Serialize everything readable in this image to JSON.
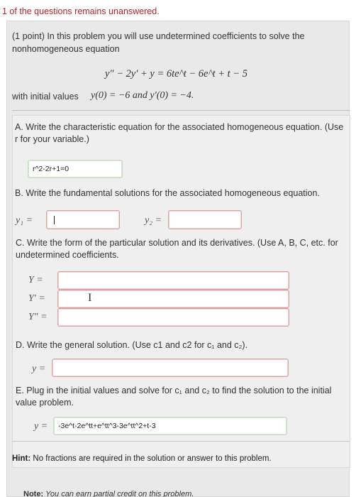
{
  "status": {
    "warning": "1 of the questions remains unanswered."
  },
  "problem": {
    "intro": "(1 point) In this problem you will use undetermined coefficients to solve the nonhomogeneous equation",
    "equation": "y″ − 2y′ + y = 6te^t − 6e^t + t − 5",
    "initial_label": "with initial values",
    "initial_values": "y(0) = −6 and y′(0) = −4."
  },
  "partA": {
    "prompt": "A. Write the characteristic equation for the associated homogeneous equation. (Use r for your variable.)",
    "answer": "r^2-2r+1=0"
  },
  "partB": {
    "prompt": "B. Write the fundamental solutions for the associated homogeneous equation.",
    "y1_label": "y₁ =",
    "y2_label": "y₂ =",
    "y1_value": "",
    "y2_value": ""
  },
  "partC": {
    "prompt": "C. Write the form of the particular solution and its derivatives. (Use A, B, C, etc. for undetermined coefficients.",
    "Y_label": "Y =",
    "Yp_label": "Y′ =",
    "Ypp_label": "Y″ =",
    "Y_value": "",
    "Yp_value": "",
    "Ypp_value": ""
  },
  "partD": {
    "prompt": "D. Write the general solution. (Use c1 and c2 for c₁ and c₂).",
    "y_label": "y =",
    "y_value": ""
  },
  "partE": {
    "prompt": "E. Plug in the initial values and solve for c₁ and c₂ to find the solution to the initial value problem.",
    "y_label": "y =",
    "answer": "-3e^t-2e^tt+e^tt^3-3e^tt^2+t-3"
  },
  "hint": {
    "label": "Hint:",
    "text": "No fractions are required in the solution or answer to this problem."
  },
  "note": {
    "label": "Note:",
    "text": "You can earn partial credit on this problem."
  },
  "colors": {
    "warning": "#b8212a",
    "correct_border": "#c9dcc2",
    "incorrect_border": "#d9a0a0",
    "panel": "#e9e9e9"
  }
}
